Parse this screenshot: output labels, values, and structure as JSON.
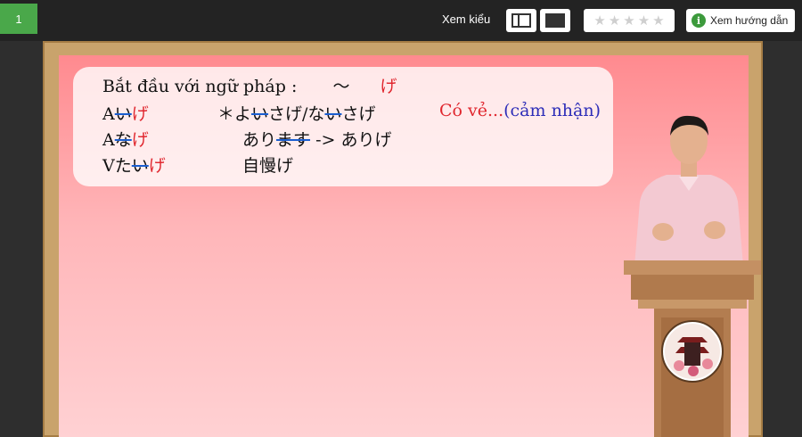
{
  "toolbar": {
    "lesson_number": "1",
    "view_label": "Xem kiểu",
    "rating_stars": 5,
    "guide_label": "Xem hướng dẫn",
    "info_glyph": "i"
  },
  "lesson": {
    "title_text": "Bắt đầu với ngữ pháp :",
    "title_tilde": "〜",
    "title_ge": "げ",
    "row1_a": "A",
    "row1_i": "い",
    "row1_ge": "げ",
    "row1_ex_mark": "＊",
    "row1_ex_yo": "よ",
    "row1_ex_i": "い",
    "row1_ex_sage": "さげ/な",
    "row1_ex_i2": "い",
    "row1_ex_sage2": "さげ",
    "row1_meaning_red": "Có vẻ...",
    "row1_meaning_blue": "(cảm nhận)",
    "row2_a": "A",
    "row2_na": "な",
    "row2_ge": "げ",
    "row2_ex_ari": "あり",
    "row2_ex_masu": "ます",
    "row2_ex_rest": " -> ありげ",
    "row3_v": "V",
    "row3_ta": "た",
    "row3_i": "い",
    "row3_ge": "げ",
    "row3_ex": "自慢げ"
  },
  "colors": {
    "accent_green": "#4aa84a",
    "red_text": "#e0262e",
    "blue_text": "#2d2db8",
    "strike_blue": "#1a5ed0"
  }
}
